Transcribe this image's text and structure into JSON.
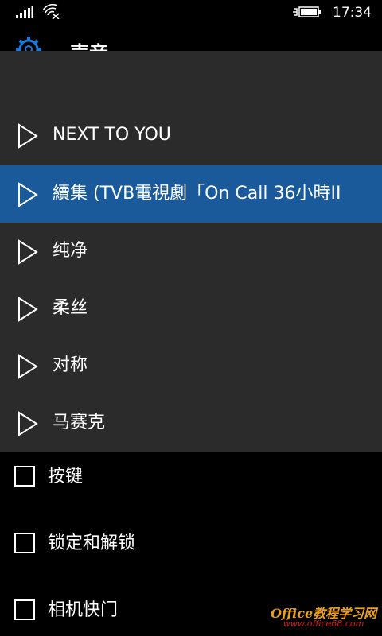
{
  "status_bar": {
    "time": "17:34",
    "signal_icon": "signal-bars-icon",
    "wifi_icon": "wifi-icon",
    "battery_icon": "battery-charging-icon"
  },
  "header": {
    "icon": "gear-icon",
    "title": "声音"
  },
  "dropdown": {
    "items": [
      {
        "label": "NEXT TO YOU",
        "icon": "play-outline-icon",
        "selected": false
      },
      {
        "label": "續集 (TVB電視劇「On Call 36小時II",
        "icon": "play-outline-icon",
        "selected": true
      },
      {
        "label": "纯净",
        "icon": "play-outline-icon",
        "selected": false
      },
      {
        "label": "柔丝",
        "icon": "play-outline-icon",
        "selected": false
      },
      {
        "label": "对称",
        "icon": "play-outline-icon",
        "selected": false
      },
      {
        "label": "马赛克",
        "icon": "play-outline-icon",
        "selected": false
      }
    ],
    "selected_color": "#1a5a9a",
    "background_color": "#2b2b2b"
  },
  "checkboxes": [
    {
      "label": "按键",
      "checked": false
    },
    {
      "label": "锁定和解锁",
      "checked": false
    },
    {
      "label": "相机快门",
      "checked": false
    }
  ],
  "watermark": {
    "line1": "Office教程学习网",
    "line2": "www.office68.com"
  }
}
